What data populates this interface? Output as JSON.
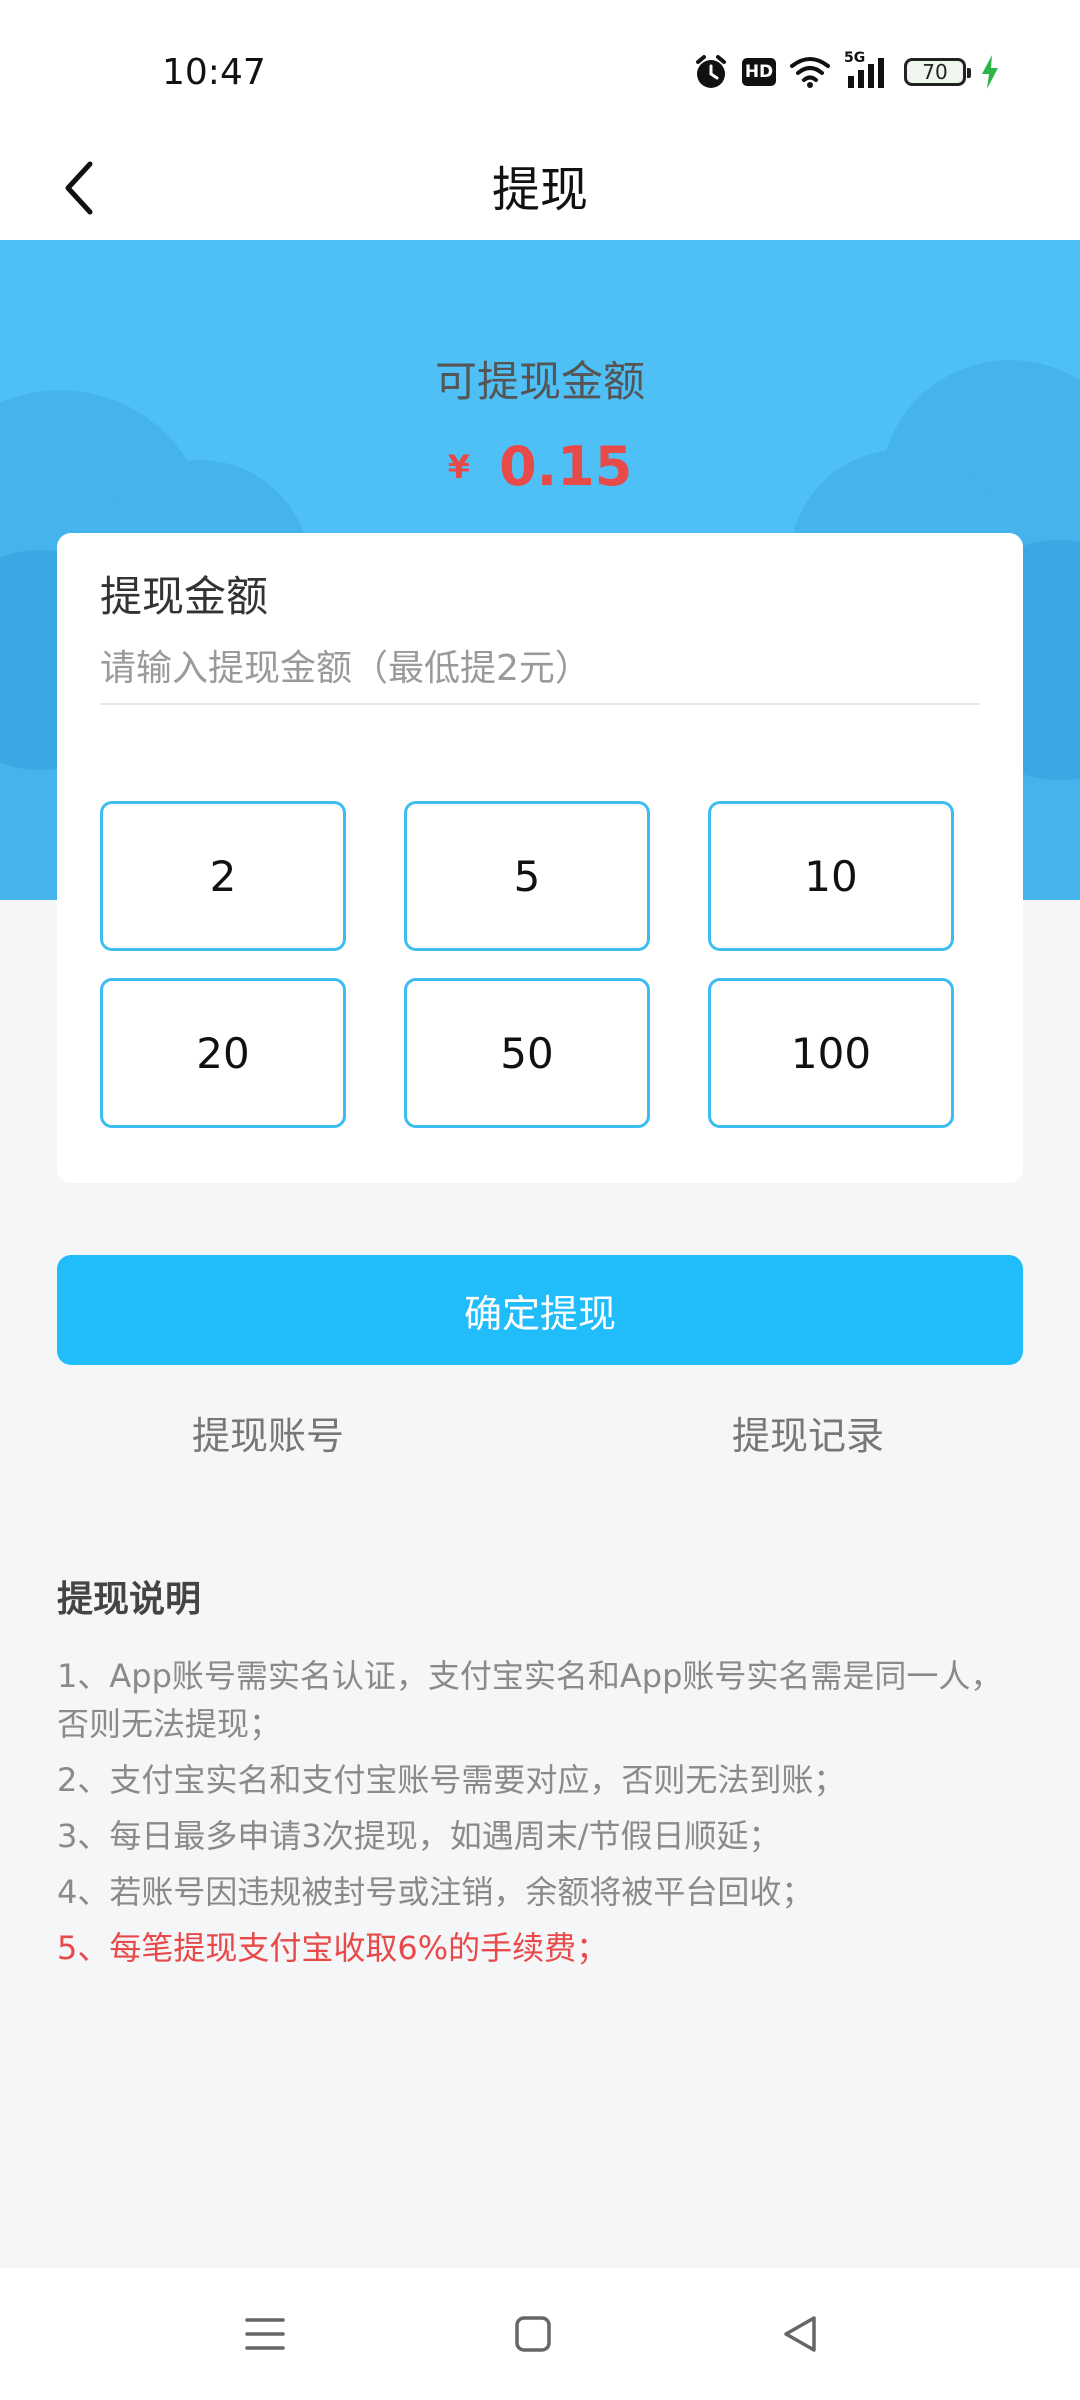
{
  "status_bar": {
    "time": "10:47",
    "hd": "HD",
    "network": "5G",
    "battery": "70",
    "icons": [
      "alarm-icon",
      "hd-icon",
      "wifi-icon",
      "signal-5g-icon",
      "battery-icon",
      "charging-icon"
    ]
  },
  "nav": {
    "title": "提现",
    "back_icon": "chevron-left-icon"
  },
  "balance": {
    "label": "可提现金额",
    "currency": "¥",
    "value": "0.15"
  },
  "form": {
    "title": "提现金额",
    "placeholder": "请输入提现金额（最低提2元）",
    "value": ""
  },
  "amount_options": [
    {
      "label": "2"
    },
    {
      "label": "5"
    },
    {
      "label": "10"
    },
    {
      "label": "20"
    },
    {
      "label": "50"
    },
    {
      "label": "100"
    }
  ],
  "actions": {
    "confirm": "确定提现",
    "account": "提现账号",
    "records": "提现记录"
  },
  "instructions": {
    "title": "提现说明",
    "items": [
      "1、App账号需实名认证，支付宝实名和App账号实名需是同一人，否则无法提现；",
      "2、支付宝实名和支付宝账号需要对应，否则无法到账；",
      "3、每日最多申请3次提现，如遇周末/节假日顺延；",
      "4、若账号因违规被封号或注销，余额将被平台回收；",
      "5、每笔提现支付宝收取6%的手续费；"
    ]
  },
  "colors": {
    "primary": "#21bdfb",
    "hero": "#4fc0f5",
    "accent_red": "#e84a4a",
    "option_border": "#3dbcee"
  },
  "system_nav": {
    "icons": [
      "menu-icon",
      "home-square-icon",
      "back-triangle-icon"
    ]
  }
}
